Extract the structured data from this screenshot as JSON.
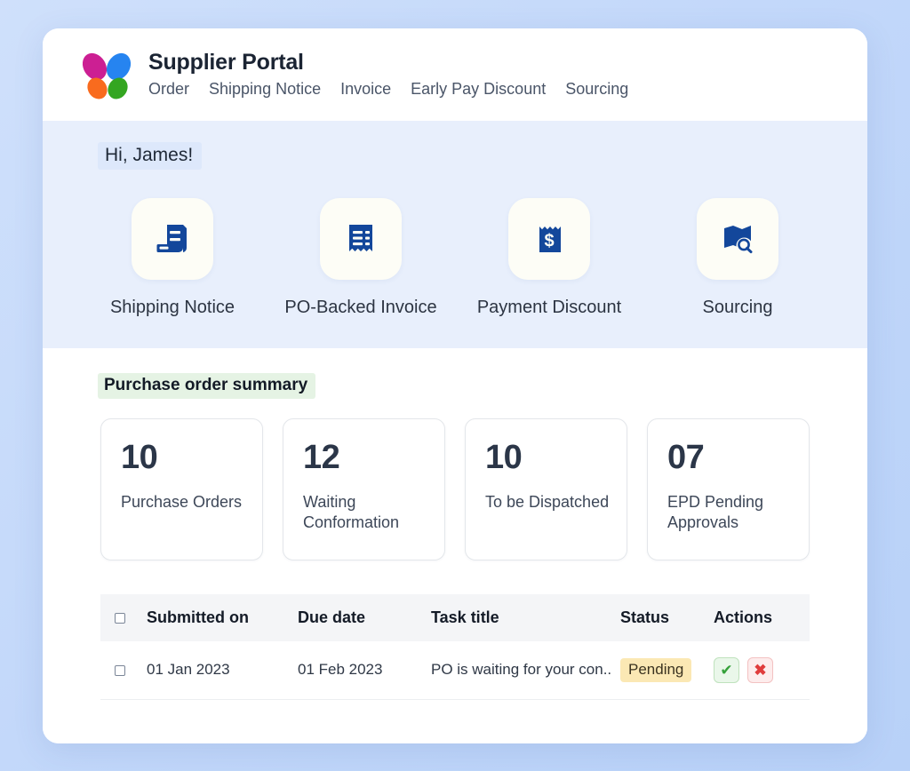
{
  "header": {
    "logo_icon": "butterfly-logo-icon",
    "title": "Supplier Portal",
    "nav": [
      {
        "label": "Order"
      },
      {
        "label": "Shipping Notice"
      },
      {
        "label": "Invoice"
      },
      {
        "label": "Early Pay Discount"
      },
      {
        "label": "Sourcing"
      }
    ]
  },
  "hero": {
    "greeting": "Hi, James!",
    "quick_actions": [
      {
        "label": "Shipping Notice",
        "icon": "shipping-notice-icon"
      },
      {
        "label": "PO-Backed Invoice",
        "icon": "invoice-receipt-icon"
      },
      {
        "label": "Payment Discount",
        "icon": "dollar-receipt-icon"
      },
      {
        "label": "Sourcing",
        "icon": "map-search-icon"
      }
    ]
  },
  "summary": {
    "title": "Purchase order summary",
    "stats": [
      {
        "value": "10",
        "label": "Purchase Orders"
      },
      {
        "value": "12",
        "label": "Waiting Conformation"
      },
      {
        "value": "10",
        "label": "To be Dispatched"
      },
      {
        "value": "07",
        "label": "EPD Pending Approvals"
      }
    ]
  },
  "table": {
    "columns": [
      {
        "key": "check",
        "label": ""
      },
      {
        "key": "sub",
        "label": "Submitted on"
      },
      {
        "key": "due",
        "label": "Due date"
      },
      {
        "key": "task",
        "label": "Task title"
      },
      {
        "key": "status",
        "label": "Status"
      },
      {
        "key": "act",
        "label": "Actions"
      }
    ],
    "rows": [
      {
        "submitted_on": "01 Jan 2023",
        "due_date": "01 Feb 2023",
        "task_title": "PO is waiting for your con..",
        "status": "Pending",
        "approve_icon": "check-icon",
        "reject_icon": "cross-icon"
      }
    ]
  },
  "colors": {
    "page_background": "#c3d8fa",
    "hero_background": "#e8effc",
    "icon_blue": "#13479b",
    "title_highlight_green": "#e5f3e4",
    "greeting_highlight_blue": "#dde8fb",
    "badge_pending": "#fbe8b4",
    "approve_green": "#35a13a",
    "reject_red": "#e03b3b"
  }
}
